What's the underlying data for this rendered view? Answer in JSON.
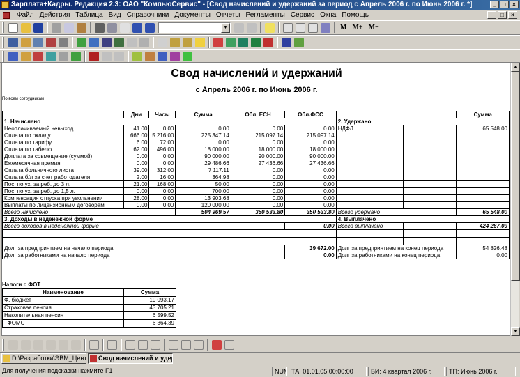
{
  "window": {
    "title": "Зарплата+Кадры. Редакция 2.3: ОАО \"КомпьюСервис\" - [Свод начислений и удержаний за период с Апрель 2006 г. по Июнь 2006 г. *]",
    "min": "_",
    "max": "□",
    "close": "×"
  },
  "menu": [
    "Файл",
    "Действия",
    "Таблица",
    "Вид",
    "Справочники",
    "Документы",
    "Отчеты",
    "Регламенты",
    "Сервис",
    "Окна",
    "Помощь"
  ],
  "toolbar": {
    "m": "M",
    "mplus": "M+",
    "mminus": "M−",
    "combo_value": ""
  },
  "report": {
    "title": "Свод начислений и удержаний",
    "period": "с Апрель 2006 г. по Июнь 2006 г.",
    "note": "По всем сотрудникам",
    "headers": {
      "days": "Дни",
      "hours": "Часы",
      "sum": "Сумма",
      "esn": "Обл. ЕСН",
      "fss": "Обл.ФСС",
      "sum2": "Сумма"
    },
    "section1": "1. Начислено",
    "section2": "2. Удержано",
    "accruals": [
      {
        "name": "Неоплачиваемый невыход",
        "days": "41.00",
        "hours": "0.00",
        "sum": "0.00",
        "esn": "0.00",
        "fss": "0.00"
      },
      {
        "name": "Оплата по окладу",
        "days": "666.00",
        "hours": "5 216.00",
        "sum": "225 347.14",
        "esn": "215 097.14",
        "fss": "215 097.14"
      },
      {
        "name": "Оплата по тарифу",
        "days": "6.00",
        "hours": "72.00",
        "sum": "0.00",
        "esn": "0.00",
        "fss": "0.00"
      },
      {
        "name": "Оплата по табелю",
        "days": "62.00",
        "hours": "496.00",
        "sum": "18 000.00",
        "esn": "18 000.00",
        "fss": "18 000.00"
      },
      {
        "name": "Доплата за совмещение (суммой)",
        "days": "0.00",
        "hours": "0.00",
        "sum": "90 000.00",
        "esn": "90 000.00",
        "fss": "90 000.00"
      },
      {
        "name": "Ежемесячная премия",
        "days": "0.00",
        "hours": "0.00",
        "sum": "29 486.66",
        "esn": "27 436.66",
        "fss": "27 436.66"
      },
      {
        "name": "Оплата больничного листа",
        "days": "39.00",
        "hours": "312.00",
        "sum": "7 117.11",
        "esn": "0.00",
        "fss": "0.00"
      },
      {
        "name": "Оплата б/л за счет работодателя",
        "days": "2.00",
        "hours": "16.00",
        "sum": "364.98",
        "esn": "0.00",
        "fss": "0.00"
      },
      {
        "name": "Пос. по ух. за реб. до 3 л.",
        "days": "21.00",
        "hours": "168.00",
        "sum": "50.00",
        "esn": "0.00",
        "fss": "0.00"
      },
      {
        "name": "Пос. по ух. за реб. до 1,5 л.",
        "days": "0.00",
        "hours": "0.00",
        "sum": "700.00",
        "esn": "0.00",
        "fss": "0.00"
      },
      {
        "name": "Компенсация отпуска при увольнении",
        "days": "28.00",
        "hours": "0.00",
        "sum": "13 903.68",
        "esn": "0.00",
        "fss": "0.00"
      },
      {
        "name": "Выплаты по лицензионным договорам",
        "days": "0.00",
        "hours": "0.00",
        "sum": "120 000.00",
        "esn": "0.00",
        "fss": "0.00"
      }
    ],
    "deductions": [
      {
        "name": "НДФЛ",
        "sum": "65 548.00"
      }
    ],
    "total_accrued_label": "Всего начислено",
    "total_accrued": "504 969.57",
    "total_esn": "350 533.80",
    "total_fss": "350 533.80",
    "total_withheld_label": "Всего удержано",
    "total_withheld": "65 548.00",
    "section3": "3. Доходы в неденежной форме",
    "section4": "4. Выплачено",
    "total_nonmonetary_label": "Всего доходов в неденежной форме",
    "total_nonmonetary": "0.00",
    "total_paid_label": "Всего выплачено",
    "total_paid": "424 267.09",
    "debt_company_start_label": "Долг за предприятием на начало периода",
    "debt_company_start": "39 672.00",
    "debt_company_end_label": "Долг за предприятием  на конец периода",
    "debt_company_end": "54 826.48",
    "debt_employees_start_label": "Долг за работниками на начало периода",
    "debt_employees_start": "0.00",
    "debt_employees_end_label": "Долг за работниками на конец периода",
    "debt_employees_end": "0.00",
    "taxes_title": "Налоги с ФОТ",
    "taxes_header": {
      "name": "Наименование",
      "sum": "Сумма"
    },
    "taxes": [
      {
        "name": "Ф. бюджет",
        "sum": "19 093.17"
      },
      {
        "name": "Страховая пенсия",
        "sum": "43 705.21"
      },
      {
        "name": "Накопительная пенсия",
        "sum": "6 599.52"
      },
      {
        "name": "ТФОМС",
        "sum": "6 364.39"
      }
    ]
  },
  "tasks": [
    {
      "label": "D:\\Разработки\\ЭВМ_Цент...",
      "active": false
    },
    {
      "label": "Свод начислений и удер...",
      "active": true
    }
  ],
  "status": {
    "hint": "Для получения подсказки нажмите F1",
    "num": "NUM",
    "ta": "ТА: 01.01.05  00:00:00",
    "bi": "БИ: 4 квартал 2006 г.",
    "tp": "ТП: Июнь 2006 г."
  }
}
